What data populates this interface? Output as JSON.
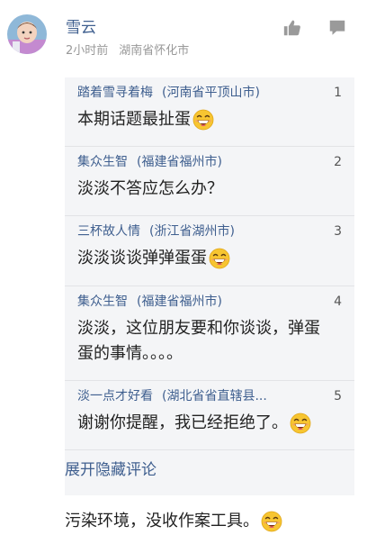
{
  "comment": {
    "username": "雪云",
    "time": "2小时前",
    "location": "湖南省怀化市",
    "text": "污染环境，没收作案工具。"
  },
  "actions": {
    "like_icon": "thumbs-up-icon",
    "reply_icon": "comment-bubble-icon"
  },
  "quotes": [
    {
      "floor": "1",
      "user": "踏着雪寻着梅",
      "location": "(河南省平顶山市)",
      "text": "本期话题最扯蛋",
      "emoji": true
    },
    {
      "floor": "2",
      "user": "集众生智",
      "location": "(福建省福州市)",
      "text": "淡淡不答应怎么办？",
      "emoji": false
    },
    {
      "floor": "3",
      "user": "三杯故人情",
      "location": "(浙江省湖州市)",
      "text": "淡淡谈谈弹弹蛋蛋",
      "emoji": true
    },
    {
      "floor": "4",
      "user": "集众生智",
      "location": "(福建省福州市)",
      "text_line1": "淡淡，这位朋友要和你谈谈，弹蛋",
      "text_line2": "蛋的事情。。。。",
      "emoji": false
    },
    {
      "floor": "5",
      "user": "淡一点才好看",
      "location": "(湖北省省直辖县...",
      "text": "谢谢你提醒，我已经拒绝了。",
      "emoji": true
    }
  ],
  "expand_label": "展开隐藏评论",
  "colors": {
    "link": "#3f5f8f",
    "quote_bg": "#f4f5f7",
    "meta": "#999999"
  }
}
